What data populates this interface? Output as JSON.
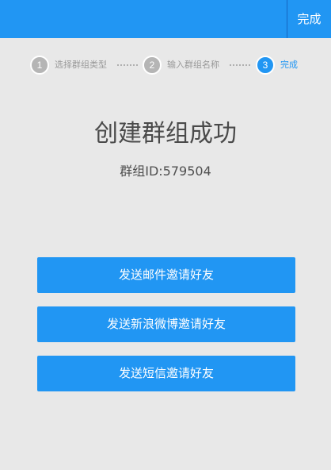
{
  "header": {
    "done_label": "完成"
  },
  "stepper": {
    "steps": [
      {
        "number": "1",
        "label": "选择群组类型",
        "state": "inactive"
      },
      {
        "number": "2",
        "label": "输入群组名称",
        "state": "inactive"
      },
      {
        "number": "3",
        "label": "完成",
        "state": "active"
      }
    ]
  },
  "main": {
    "title": "创建群组成功",
    "group_id_text": "群组ID:579504"
  },
  "actions": {
    "email_invite": "发送邮件邀请好友",
    "weibo_invite": "发送新浪微博邀请好友",
    "sms_invite": "发送短信邀请好友"
  },
  "colors": {
    "accent": "#2196f3",
    "background": "#e8e8e8"
  }
}
